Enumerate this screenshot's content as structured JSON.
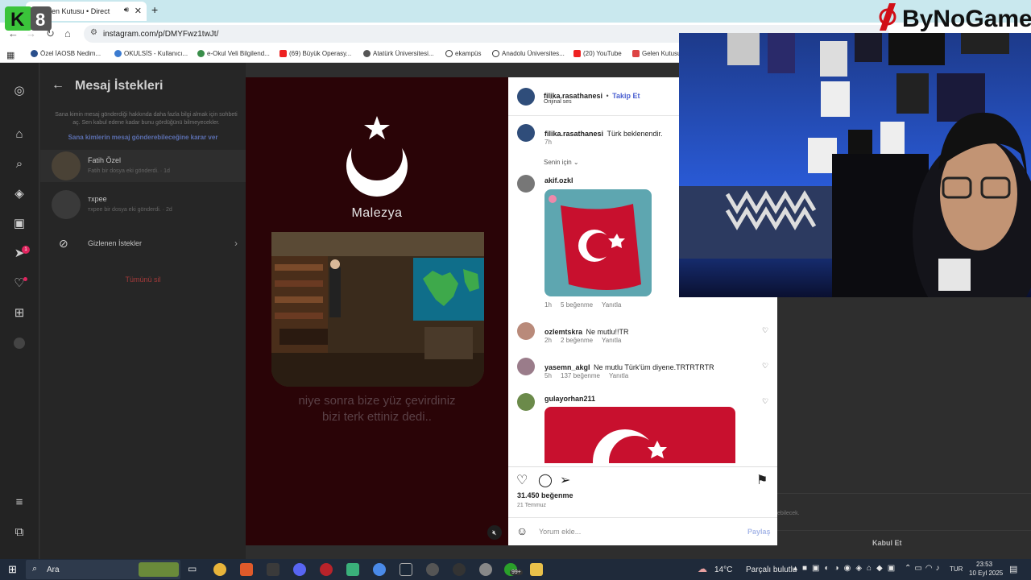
{
  "browser": {
    "tab_title": "Gelen Kutusu • Direct",
    "url": "instagram.com/p/DMYFwz1twJt/",
    "bookmarks": [
      "Özel İAOSB Nedim...",
      "OKULSİS - Kullanıcı...",
      "e-Okul Veli Bilgilend...",
      "(69) Büyük Operasy...",
      "Atatürk Üniversitesi...",
      "ekampüs",
      "Anadolu Üniversites...",
      "(20) YouTube",
      "Gelen Kutusu"
    ]
  },
  "overlays": {
    "left_logo": "K8",
    "right_logo": "ByNoGame"
  },
  "sidebar": {
    "icons": [
      "instagram-icon",
      "home-icon",
      "search-icon",
      "explore-icon",
      "reels-icon",
      "messages-icon",
      "notifications-icon",
      "create-icon",
      "profile-icon",
      "menu-icon",
      "meta-icon"
    ],
    "messages_badge": "1"
  },
  "requests_panel": {
    "title": "Mesaj İstekleri",
    "info": "Sana kimin mesaj gönderdiği hakkında daha fazla bilgi almak için sohbeti aç. Sen kabul edene kadar bunu gördüğünü bilmeyecekler.",
    "decide_link": "Sana kimlerin mesaj gönderebileceğine karar ver",
    "requests": [
      {
        "name": "Fatih Özel",
        "subtitle": "Fatih bir dosya eki gönderdi. · 1d"
      },
      {
        "name": "тxpee",
        "subtitle": "тxpee bir dosya eki gönderdi. · 2d"
      }
    ],
    "hidden_requests": "Gizlenen İstekler",
    "delete_all": "Tümünü sil"
  },
  "chat_bg": {
    "accept_label": "Kabul Et",
    "fragment": "ebilecek."
  },
  "reel": {
    "country": "Malezya",
    "caption_line1": "niye sonra bize yüz çevirdiniz",
    "caption_line2": "bizi terk ettiniz dedi..",
    "mute_icon": "sound-icon"
  },
  "post": {
    "author": "filika.rasathanesi",
    "follow": "Takip Et",
    "separator": "•",
    "audio": "Orijinal ses",
    "author_caption": "Türk beklenendir.",
    "author_time": "7h",
    "for_you": "Senin için",
    "comments": [
      {
        "user": "akif.ozkl",
        "text": "",
        "time": "1h",
        "likes": "5 beğenme",
        "reply": "Yanıtla"
      },
      {
        "user": "ozlemtskra",
        "text": "Ne mutlu!!TR",
        "time": "2h",
        "likes": "2 beğenme",
        "reply": "Yanıtla"
      },
      {
        "user": "yasemn_akgl",
        "text": "Ne mutlu Türk'üm diyene.TRTRTRTR",
        "time": "5h",
        "likes": "137 beğenme",
        "reply": "Yanıtla"
      },
      {
        "user": "gulayorhan211",
        "text": "",
        "time": "",
        "likes": "",
        "reply": ""
      }
    ],
    "like_count": "31.450 beğenme",
    "date": "21 Temmuz",
    "comment_placeholder": "Yorum ekle...",
    "share_label": "Paylaş"
  },
  "taskbar": {
    "search_label": "Ara",
    "weather": "14°C",
    "weather_desc": "Parçalı bulutlu",
    "language": "TUR",
    "time": "23:53",
    "date": "10 Eyl 2025",
    "steam_badge": "99+"
  },
  "colors": {
    "accent": "#5b6fb0",
    "reel_bg": "#2a0407",
    "flag_red": "#c8102e",
    "delete_red": "#a33a3a"
  }
}
